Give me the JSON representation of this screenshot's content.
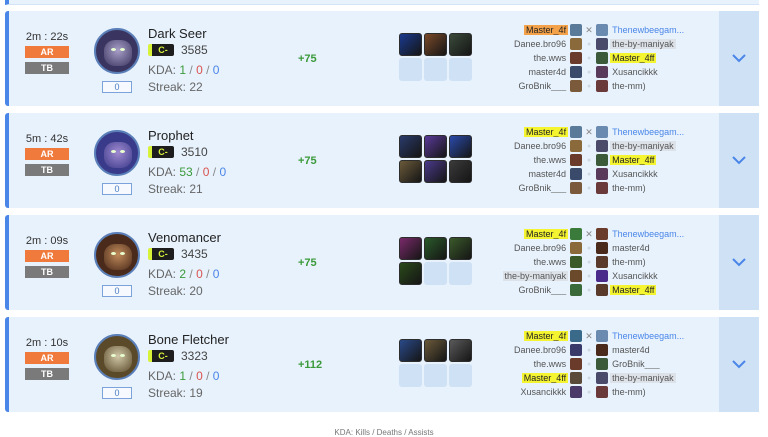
{
  "matches": [
    {
      "duration": "2m : 22s",
      "badge_ar": "AR",
      "badge_tb": "TB",
      "level": "0",
      "hero": "Dark Seer",
      "hero_colors": [
        "#3a3560",
        "#a89fc7"
      ],
      "rank_badge": "C-",
      "mmr": "3585",
      "kda_label": "KDA:",
      "kills": "1",
      "deaths": "0",
      "assists": "0",
      "streak": "Streak: 22",
      "gain": "+75",
      "items": [
        {
          "color": "#1a3a8f"
        },
        {
          "color": "#7a4a2a"
        },
        {
          "color": "#3a4a3a"
        },
        {
          "color": ""
        },
        {
          "color": ""
        },
        {
          "color": ""
        }
      ],
      "players": [
        {
          "left": "Master_4f",
          "left_hl": "orange",
          "left_icon": "#5a7a9a",
          "right": "Thenewbeegam...",
          "right_hl": "link",
          "right_icon": "#6a8ab0"
        },
        {
          "left": "Danee.bro96",
          "left_hl": "",
          "left_icon": "#8a6a3a",
          "right": "the-by-maniyak",
          "right_hl": "gray",
          "right_icon": "#4a4a6a"
        },
        {
          "left": "the.wws",
          "left_hl": "",
          "left_icon": "#6a3a2a",
          "right": "Master_4ff",
          "right_hl": "yellow",
          "right_icon": "#3a5a3a"
        },
        {
          "left": "master4d",
          "left_hl": "",
          "left_icon": "#3a4a6a",
          "right": "Xusancikkk",
          "right_hl": "",
          "right_icon": "#5a3a5a"
        },
        {
          "left": "GroBnik___",
          "left_hl": "",
          "left_icon": "#7a5a3a",
          "right": "the-mm)",
          "right_hl": "",
          "right_icon": "#6a3a3a"
        }
      ]
    },
    {
      "duration": "5m : 42s",
      "badge_ar": "AR",
      "badge_tb": "TB",
      "level": "0",
      "hero": "Prophet",
      "hero_colors": [
        "#3a3a8a",
        "#a08ad0"
      ],
      "rank_badge": "C-",
      "mmr": "3510",
      "kda_label": "KDA:",
      "kills": "53",
      "deaths": "0",
      "assists": "0",
      "streak": "Streak: 21",
      "gain": "+75",
      "items": [
        {
          "color": "#2a3a6a"
        },
        {
          "color": "#5a3a9a"
        },
        {
          "color": "#2a4aaa"
        },
        {
          "color": "#6a5a3a"
        },
        {
          "color": "#4a3a8a"
        },
        {
          "color": "#3a3a3a"
        }
      ],
      "players": [
        {
          "left": "Master_4f",
          "left_hl": "yellow",
          "left_icon": "#5a7a9a",
          "right": "Thenewbeegam...",
          "right_hl": "link",
          "right_icon": "#6a8ab0"
        },
        {
          "left": "Danee.bro96",
          "left_hl": "",
          "left_icon": "#8a6a3a",
          "right": "the-by-maniyak",
          "right_hl": "gray",
          "right_icon": "#4a4a6a"
        },
        {
          "left": "the.wws",
          "left_hl": "",
          "left_icon": "#6a3a2a",
          "right": "Master_4ff",
          "right_hl": "yellow",
          "right_icon": "#3a5a3a"
        },
        {
          "left": "master4d",
          "left_hl": "",
          "left_icon": "#3a4a6a",
          "right": "Xusancikkk",
          "right_hl": "",
          "right_icon": "#5a3a5a"
        },
        {
          "left": "GroBnik___",
          "left_hl": "",
          "left_icon": "#7a5a3a",
          "right": "the-mm)",
          "right_hl": "",
          "right_icon": "#6a3a3a"
        }
      ]
    },
    {
      "duration": "2m : 09s",
      "badge_ar": "AR",
      "badge_tb": "TB",
      "level": "0",
      "hero": "Venomancer",
      "hero_colors": [
        "#4a2a1a",
        "#c08a5a"
      ],
      "rank_badge": "C-",
      "mmr": "3435",
      "kda_label": "KDA:",
      "kills": "2",
      "deaths": "0",
      "assists": "0",
      "streak": "Streak: 20",
      "gain": "+75",
      "items": [
        {
          "color": "#7a2a6a"
        },
        {
          "color": "#2a5a2a"
        },
        {
          "color": "#3a5a2a"
        },
        {
          "color": "#2a4a1a"
        },
        {
          "color": ""
        },
        {
          "color": ""
        }
      ],
      "players": [
        {
          "left": "Master_4f",
          "left_hl": "yellow",
          "left_icon": "#3a7a3a",
          "right": "Thenewbeegam...",
          "right_hl": "link",
          "right_icon": "#6a3a2a"
        },
        {
          "left": "Danee.bro96",
          "left_hl": "",
          "left_icon": "#8a6a3a",
          "right": "master4d",
          "right_hl": "",
          "right_icon": "#4a2a1a"
        },
        {
          "left": "the.wws",
          "left_hl": "",
          "left_icon": "#3a5a2a",
          "right": "the-mm)",
          "right_hl": "",
          "right_icon": "#5a3a2a"
        },
        {
          "left": "the-by-maniyak",
          "left_hl": "gray",
          "left_icon": "#6a4a2a",
          "right": "Xusancikkk",
          "right_hl": "",
          "right_icon": "#4a2a8a"
        },
        {
          "left": "GroBnik___",
          "left_hl": "",
          "left_icon": "#3a6a3a",
          "right": "Master_4ff",
          "right_hl": "yellow",
          "right_icon": "#5a3a2a"
        }
      ]
    },
    {
      "duration": "2m : 10s",
      "badge_ar": "AR",
      "badge_tb": "TB",
      "level": "0",
      "hero": "Bone Fletcher",
      "hero_colors": [
        "#5a4a2a",
        "#d0c8a8"
      ],
      "rank_badge": "C-",
      "mmr": "3323",
      "kda_label": "KDA:",
      "kills": "1",
      "deaths": "0",
      "assists": "0",
      "streak": "Streak: 19",
      "gain": "+112",
      "items": [
        {
          "color": "#2a4a8a"
        },
        {
          "color": "#6a5a3a"
        },
        {
          "color": "#5a5a5a"
        },
        {
          "color": ""
        },
        {
          "color": ""
        },
        {
          "color": ""
        }
      ],
      "players": [
        {
          "left": "Master_4f",
          "left_hl": "yellow",
          "left_icon": "#3a6a8a",
          "right": "Thenewbeegam...",
          "right_hl": "link",
          "right_icon": "#6a8ab0"
        },
        {
          "left": "Danee.bro96",
          "left_hl": "",
          "left_icon": "#3a3a6a",
          "right": "master4d",
          "right_hl": "",
          "right_icon": "#4a2a1a"
        },
        {
          "left": "the.wws",
          "left_hl": "",
          "left_icon": "#6a3a2a",
          "right": "GroBnik___",
          "right_hl": "",
          "right_icon": "#3a5a3a"
        },
        {
          "left": "Master_4ff",
          "left_hl": "yellow",
          "left_icon": "#5a4a3a",
          "right": "the-by-maniyak",
          "right_hl": "gray",
          "right_icon": "#4a4a6a"
        },
        {
          "left": "Xusancikkk",
          "left_hl": "",
          "left_icon": "#4a3a6a",
          "right": "the-mm)",
          "right_hl": "",
          "right_icon": "#6a3a3a"
        }
      ]
    }
  ],
  "footer": "KDA: Kills / Deaths / Assists",
  "colors": {
    "accent": "#4a86e8",
    "card_bg": "#e8f2fc",
    "ar": "#f07a3c",
    "tb": "#7a7a7a",
    "gain": "#3a9a3a"
  }
}
